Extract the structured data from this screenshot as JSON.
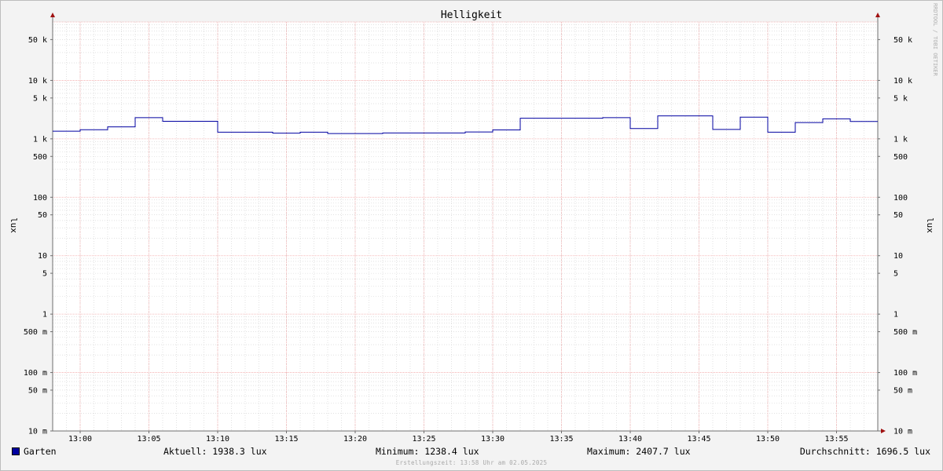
{
  "chart_data": {
    "type": "line",
    "title": "Helligkeit",
    "ylabel": "lux",
    "yscale": "log",
    "ylim": [
      0.01,
      100000
    ],
    "y_ticks": [
      {
        "v": 50000,
        "label": "50 k"
      },
      {
        "v": 10000,
        "label": "10 k"
      },
      {
        "v": 5000,
        "label": "5 k"
      },
      {
        "v": 1000,
        "label": "1 k"
      },
      {
        "v": 500,
        "label": "500"
      },
      {
        "v": 100,
        "label": "100"
      },
      {
        "v": 50,
        "label": "50"
      },
      {
        "v": 10,
        "label": "10"
      },
      {
        "v": 5,
        "label": "5"
      },
      {
        "v": 1,
        "label": "1"
      },
      {
        "v": 0.5,
        "label": "500 m"
      },
      {
        "v": 0.1,
        "label": "100 m"
      },
      {
        "v": 0.05,
        "label": "50 m"
      },
      {
        "v": 0.01,
        "label": "10 m"
      }
    ],
    "x_ticks": [
      "13:00",
      "13:05",
      "13:10",
      "13:15",
      "13:20",
      "13:25",
      "13:30",
      "13:35",
      "13:40",
      "13:45",
      "13:50",
      "13:55"
    ],
    "xlim": [
      "12:58",
      "13:58"
    ],
    "grid": true,
    "series": [
      {
        "name": "Garten",
        "color": "#0000a0",
        "step": true,
        "x": [
          "12:58",
          "13:00",
          "13:02",
          "13:04",
          "13:06",
          "13:08",
          "13:10",
          "13:12",
          "13:14",
          "13:16",
          "13:18",
          "13:20",
          "13:22",
          "13:24",
          "13:26",
          "13:28",
          "13:30",
          "13:32",
          "13:34",
          "13:36",
          "13:38",
          "13:40",
          "13:42",
          "13:44",
          "13:46",
          "13:48",
          "13:50",
          "13:52",
          "13:54",
          "13:56",
          "13:58"
        ],
        "values": [
          1350,
          1430,
          1600,
          2300,
          2000,
          2000,
          1300,
          1300,
          1250,
          1300,
          1230,
          1230,
          1260,
          1260,
          1260,
          1310,
          1420,
          2250,
          2250,
          2250,
          2300,
          1500,
          2470,
          2470,
          1450,
          2350,
          1300,
          1900,
          2200,
          1980,
          1980
        ]
      }
    ]
  },
  "legend": {
    "series_name": "Garten",
    "swatch_color": "#0000a0"
  },
  "stats": {
    "current": "Aktuell: 1938.3 lux",
    "minimum": "Minimum: 1238.4 lux",
    "maximum": "Maximum: 2407.7 lux",
    "average": "Durchschnitt: 1696.5 lux"
  },
  "footer_text": "Erstellungszeit: 13:58 Uhr am 02.05.2025",
  "watermark": "RRDTOOL / TOBI OETIKER",
  "colors": {
    "major_grid": "#f2a8a8",
    "minor_grid": "#d0d0d0",
    "axis": "#6f6f6f",
    "arrow": "#a01010"
  }
}
